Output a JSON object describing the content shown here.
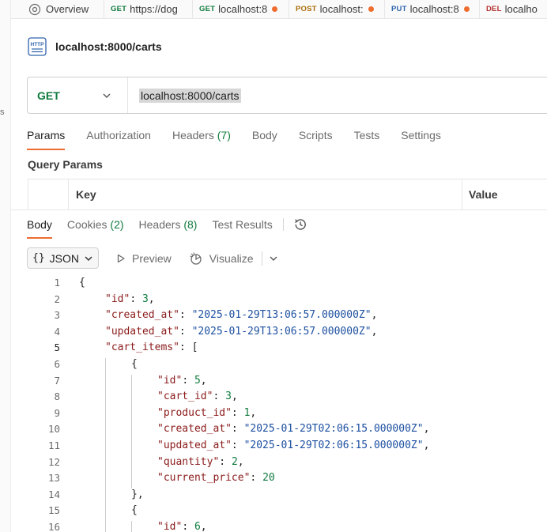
{
  "sidebar_fragments": [
    "s"
  ],
  "tabs": [
    {
      "label": "Overview",
      "method": "",
      "dot": false,
      "icon": "overview-icon"
    },
    {
      "label": "https://dog",
      "method": "GET",
      "dot": false
    },
    {
      "label": "localhost:8",
      "method": "GET",
      "dot": true
    },
    {
      "label": "localhost:",
      "method": "POST",
      "dot": true
    },
    {
      "label": "localhost:8",
      "method": "PUT",
      "dot": true
    },
    {
      "label": "localho",
      "method": "DEL",
      "dot": false
    }
  ],
  "request": {
    "name": "localhost:8000/carts",
    "method": "GET",
    "url": "localhost:8000/carts"
  },
  "request_tabs": [
    {
      "label": "Params",
      "count": "",
      "active": true
    },
    {
      "label": "Authorization",
      "count": "",
      "active": false
    },
    {
      "label": "Headers",
      "count": "(7)",
      "active": false
    },
    {
      "label": "Body",
      "count": "",
      "active": false
    },
    {
      "label": "Scripts",
      "count": "",
      "active": false
    },
    {
      "label": "Tests",
      "count": "",
      "active": false
    },
    {
      "label": "Settings",
      "count": "",
      "active": false
    }
  ],
  "query_params": {
    "title": "Query Params",
    "columns": [
      "Key",
      "Value"
    ]
  },
  "response_tabs": [
    {
      "label": "Body",
      "count": "",
      "active": true
    },
    {
      "label": "Cookies",
      "count": "(2)",
      "active": false
    },
    {
      "label": "Headers",
      "count": "(8)",
      "active": false
    },
    {
      "label": "Test Results",
      "count": "",
      "active": false
    }
  ],
  "response_toolbar": {
    "format": "JSON",
    "format_braces": "{}",
    "preview": "Preview",
    "visualize": "Visualize"
  },
  "code_lines": [
    {
      "n": "1",
      "indent": 0,
      "tokens": [
        [
          "p",
          "{"
        ]
      ]
    },
    {
      "n": "2",
      "indent": 1,
      "tokens": [
        [
          "k",
          "\"id\""
        ],
        [
          "p",
          ": "
        ],
        [
          "n",
          "3"
        ],
        [
          "p",
          ","
        ]
      ]
    },
    {
      "n": "3",
      "indent": 1,
      "tokens": [
        [
          "k",
          "\"created_at\""
        ],
        [
          "p",
          ": "
        ],
        [
          "s",
          "\"2025-01-29T13:06:57.000000Z\""
        ],
        [
          "p",
          ","
        ]
      ]
    },
    {
      "n": "4",
      "indent": 1,
      "tokens": [
        [
          "k",
          "\"updated_at\""
        ],
        [
          "p",
          ": "
        ],
        [
          "s",
          "\"2025-01-29T13:06:57.000000Z\""
        ],
        [
          "p",
          ","
        ]
      ]
    },
    {
      "n": "5",
      "indent": 1,
      "tokens": [
        [
          "k",
          "\"cart_items\""
        ],
        [
          "p",
          ": ["
        ]
      ]
    },
    {
      "n": "6",
      "indent": 2,
      "tokens": [
        [
          "p",
          "{"
        ]
      ]
    },
    {
      "n": "7",
      "indent": 3,
      "tokens": [
        [
          "k",
          "\"id\""
        ],
        [
          "p",
          ": "
        ],
        [
          "n",
          "5"
        ],
        [
          "p",
          ","
        ]
      ]
    },
    {
      "n": "8",
      "indent": 3,
      "tokens": [
        [
          "k",
          "\"cart_id\""
        ],
        [
          "p",
          ": "
        ],
        [
          "n",
          "3"
        ],
        [
          "p",
          ","
        ]
      ]
    },
    {
      "n": "9",
      "indent": 3,
      "tokens": [
        [
          "k",
          "\"product_id\""
        ],
        [
          "p",
          ": "
        ],
        [
          "n",
          "1"
        ],
        [
          "p",
          ","
        ]
      ]
    },
    {
      "n": "10",
      "indent": 3,
      "tokens": [
        [
          "k",
          "\"created_at\""
        ],
        [
          "p",
          ": "
        ],
        [
          "s",
          "\"2025-01-29T02:06:15.000000Z\""
        ],
        [
          "p",
          ","
        ]
      ]
    },
    {
      "n": "11",
      "indent": 3,
      "tokens": [
        [
          "k",
          "\"updated_at\""
        ],
        [
          "p",
          ": "
        ],
        [
          "s",
          "\"2025-01-29T02:06:15.000000Z\""
        ],
        [
          "p",
          ","
        ]
      ]
    },
    {
      "n": "12",
      "indent": 3,
      "tokens": [
        [
          "k",
          "\"quantity\""
        ],
        [
          "p",
          ": "
        ],
        [
          "n",
          "2"
        ],
        [
          "p",
          ","
        ]
      ]
    },
    {
      "n": "13",
      "indent": 3,
      "tokens": [
        [
          "k",
          "\"current_price\""
        ],
        [
          "p",
          ": "
        ],
        [
          "n",
          "20"
        ]
      ]
    },
    {
      "n": "14",
      "indent": 2,
      "tokens": [
        [
          "p",
          "},"
        ]
      ]
    },
    {
      "n": "15",
      "indent": 2,
      "tokens": [
        [
          "p",
          "{"
        ]
      ]
    },
    {
      "n": "16",
      "indent": 3,
      "tokens": [
        [
          "k",
          "\"id\""
        ],
        [
          "p",
          ": "
        ],
        [
          "n",
          "6"
        ],
        [
          "p",
          ","
        ]
      ]
    }
  ],
  "current_line": "5",
  "colors": {
    "accent": "#ef6c2f",
    "get": "#0f7b3f",
    "post": "#ab6e0b",
    "put": "#2f63ae",
    "del": "#b32f2f",
    "json_key": "#8b1a1a",
    "json_string": "#1c4fa0",
    "json_number": "#0f7b3f"
  }
}
